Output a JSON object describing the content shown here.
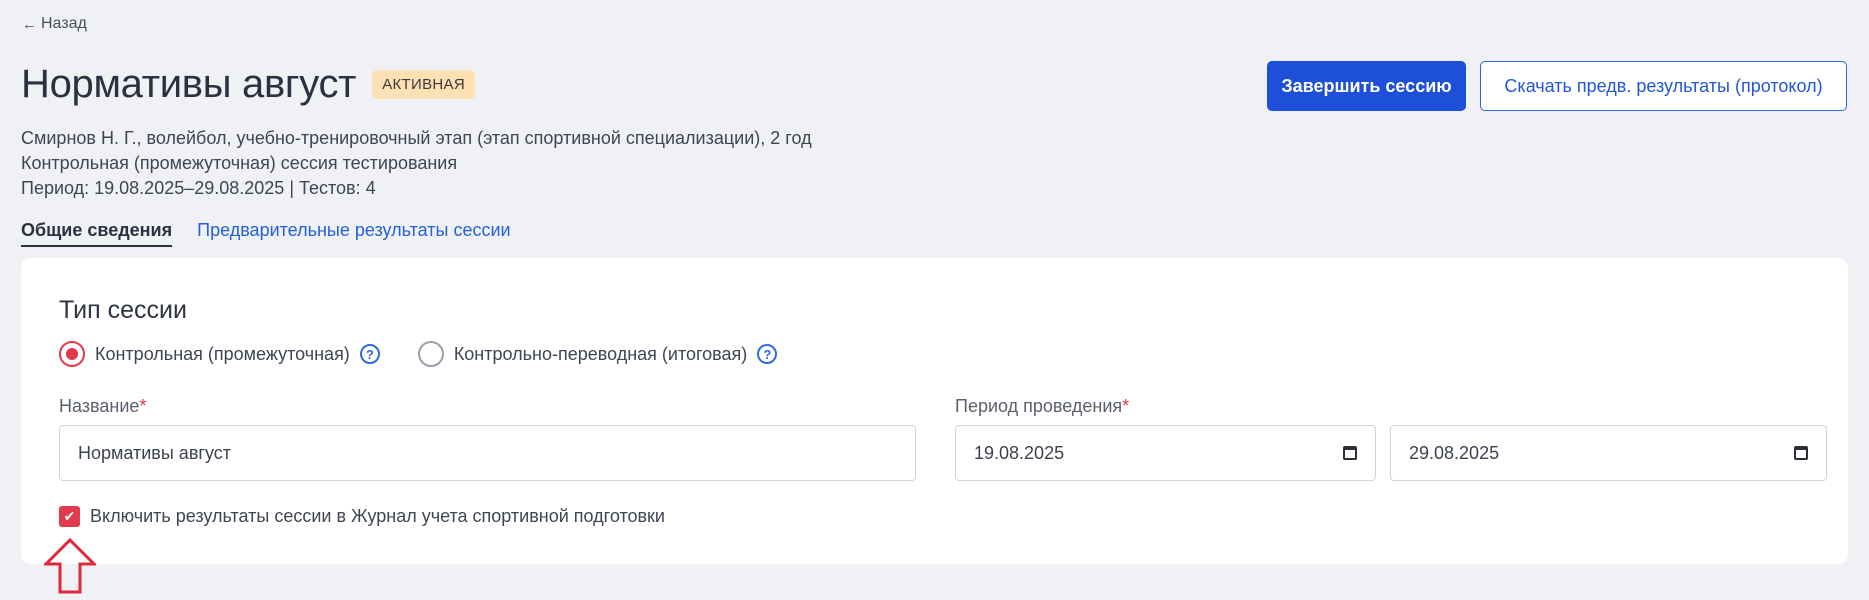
{
  "nav": {
    "back_arrow": "←",
    "back_label": "Назад"
  },
  "header": {
    "title": "Нормативы август",
    "status_badge": "АКТИВНАЯ",
    "finish_button": "Завершить сессию",
    "download_button": "Скачать предв. результаты (протокол)"
  },
  "meta": {
    "line1": "Смирнов Н. Г., волейбол, учебно-тренировочный этап (этап спортивной специализации), 2 год",
    "line2": "Контрольная (промежуточная) сессия тестирования",
    "line3": "Период: 19.08.2025–29.08.2025 | Тестов: 4"
  },
  "tabs": [
    {
      "label": "Общие сведения",
      "active": true
    },
    {
      "label": "Предварительные результаты сессии",
      "active": false
    }
  ],
  "form": {
    "section_title": "Тип сессии",
    "session_types": [
      {
        "label": "Контрольная (промежуточная)",
        "selected": true,
        "help": "?"
      },
      {
        "label": "Контрольно-переводная (итоговая)",
        "selected": false,
        "help": "?"
      }
    ],
    "name_label": "Название",
    "name_value": "Нормативы август",
    "period_label": "Период проведения",
    "required_mark": "*",
    "date_from": "19.08.2025",
    "date_to": "29.08.2025",
    "include_journal_label": "Включить результаты сессии в Журнал учета спортивной подготовки",
    "include_journal_checked": true,
    "checkmark": "✔"
  },
  "colors": {
    "primary": "#1d4fd8",
    "link": "#2461d8",
    "accent_red": "#e3394d",
    "badge_bg": "#fde0b4",
    "page_bg": "#f0f1f5"
  },
  "icons": {
    "back": "arrow-left-icon",
    "help": "question-circle-icon",
    "calendar": "calendar-icon",
    "check": "check-icon",
    "annotation": "arrow-up-outline-icon"
  }
}
